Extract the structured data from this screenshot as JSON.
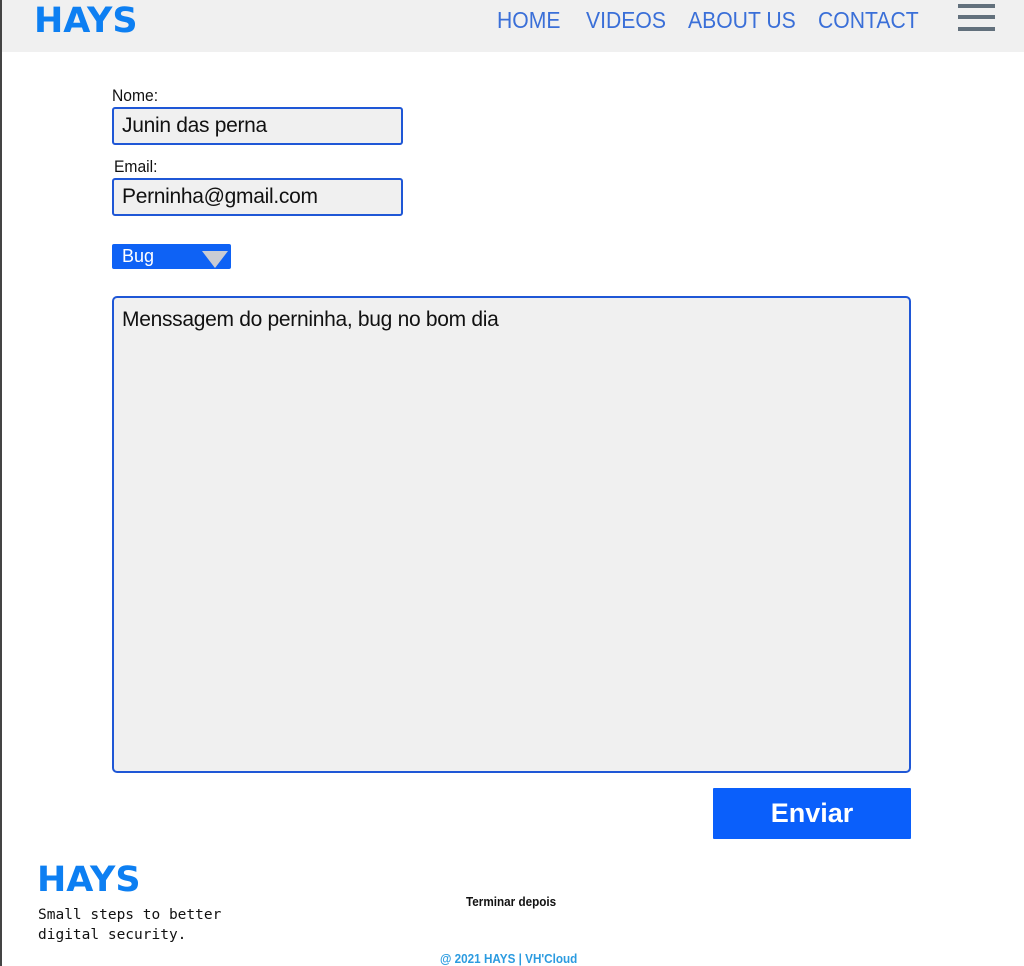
{
  "header": {
    "logo": "HAYS",
    "nav": {
      "home": "HOME",
      "videos": "VIDEOS",
      "about": "ABOUT US",
      "contact": "CONTACT"
    },
    "menu_icon": "hamburger-menu-icon"
  },
  "form": {
    "name_label": "Nome:",
    "name_value": "Junin das perna",
    "email_label": "Email:",
    "email_value": "Perninha@gmail.com",
    "category_selected": "Bug",
    "category_icon": "dropdown-triangle-icon",
    "message_value": "Menssagem do perninha, bug no bom dia",
    "submit_label": "Enviar"
  },
  "footer": {
    "logo": "HAYS",
    "tagline": "Small steps to better digital security.",
    "note": "Terminar depois",
    "copyright": "@ 2021 HAYS | VH'Cloud"
  },
  "colors": {
    "brand": "#0d7ff2",
    "nav": "#3a6fd8",
    "field_border": "#1f57d6",
    "button": "#0a5ffb",
    "copyright": "#2b9be0"
  }
}
